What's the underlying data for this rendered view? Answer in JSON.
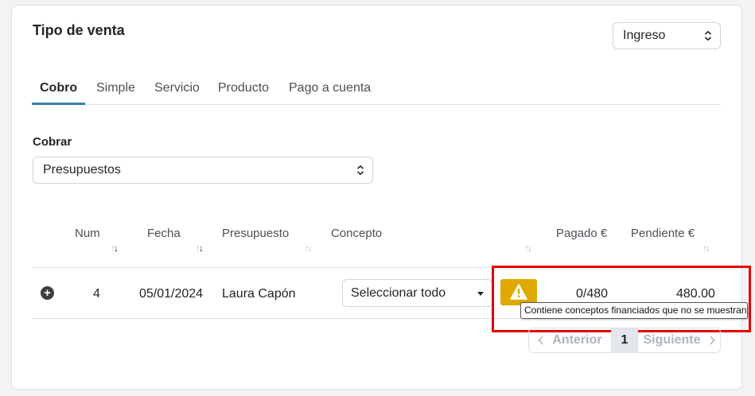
{
  "header": {
    "title": "Tipo de venta",
    "type_select_value": "Ingreso"
  },
  "tabs": [
    {
      "label": "Cobro"
    },
    {
      "label": "Simple"
    },
    {
      "label": "Servicio"
    },
    {
      "label": "Producto"
    },
    {
      "label": "Pago a cuenta"
    }
  ],
  "cobrar": {
    "label": "Cobrar",
    "value": "Presupuestos"
  },
  "table": {
    "columns": [
      "Num",
      "Fecha",
      "Presupuesto",
      "Concepto",
      "Pagado €",
      "Pendiente €"
    ],
    "rows": [
      {
        "num": "4",
        "fecha": "05/01/2024",
        "presupuesto": "Laura Capón",
        "concepto": "Seleccionar todo",
        "pagado": "0/480",
        "pendiente": "480.00"
      }
    ]
  },
  "tooltip": {
    "text": "Contiene conceptos financiados que no se muestran"
  },
  "pagination": {
    "prev": "Anterior",
    "page": "1",
    "next": "Siguiente"
  },
  "colors": {
    "tab_underline": "#3d7ea6",
    "warning": "#e0a800",
    "highlight": "#e60000"
  },
  "icons": [
    "chevron-updown-icon",
    "plus-circle-icon",
    "warning-icon",
    "sort-icon",
    "chevron-left-icon",
    "chevron-right-icon",
    "caret-down-icon"
  ]
}
